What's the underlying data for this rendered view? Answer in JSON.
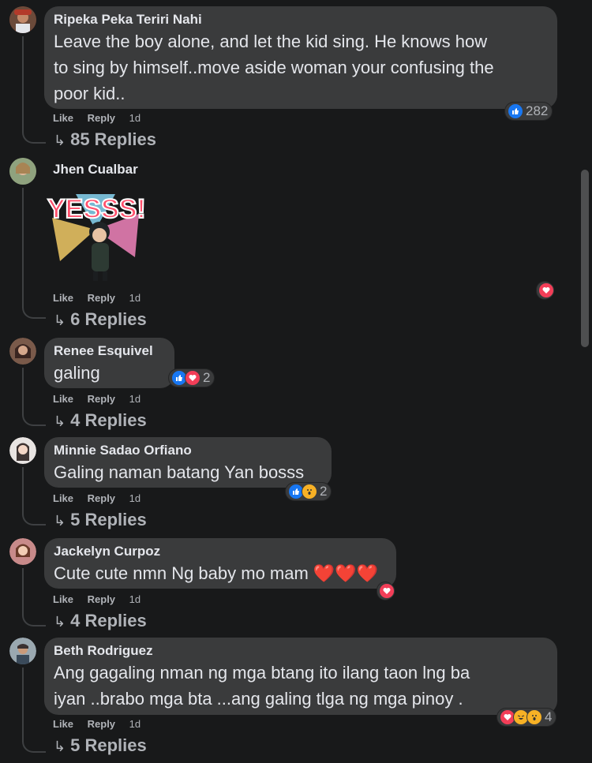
{
  "comments": [
    {
      "author": "Ripeka Peka Teriri Nahi",
      "text_lines": [
        "Leave the boy alone, and let the kid sing. He knows how",
        "to sing by himself..move aside woman your confusing the",
        "poor kid.."
      ],
      "like": "Like",
      "reply": "Reply",
      "time": "1d",
      "replies": "85 Replies",
      "reaction_count": "282",
      "reactions": [
        "like"
      ]
    },
    {
      "author": "Jhen Cualbar",
      "sticker_text": "YESSS!",
      "like": "Like",
      "reply": "Reply",
      "time": "1d",
      "replies": "6 Replies",
      "reaction_count": "",
      "reactions": [
        "love"
      ]
    },
    {
      "author": "Renee Esquivel",
      "text_lines": [
        "galing"
      ],
      "like": "Like",
      "reply": "Reply",
      "time": "1d",
      "replies": "4 Replies",
      "reaction_count": "2",
      "reactions": [
        "like",
        "love"
      ]
    },
    {
      "author": "Minnie Sadao Orfiano",
      "text_lines": [
        "Galing naman batang Yan bosss"
      ],
      "like": "Like",
      "reply": "Reply",
      "time": "1d",
      "replies": "5 Replies",
      "reaction_count": "2",
      "reactions": [
        "like",
        "wow"
      ]
    },
    {
      "author": "Jackelyn Curpoz",
      "text_lines": [
        "Cute cute nmn Ng baby mo mam ❤️❤️❤️"
      ],
      "like": "Like",
      "reply": "Reply",
      "time": "1d",
      "replies": "4 Replies",
      "reaction_count": "",
      "reactions": [
        "love"
      ]
    },
    {
      "author": "Beth Rodriguez",
      "text_lines": [
        "Ang gagaling nman ng mga btang ito ilang taon lng ba",
        "iyan ..brabo mga bta ...ang galing tlga ng mga pinoy ."
      ],
      "like": "Like",
      "reply": "Reply",
      "time": "1d",
      "replies": "5 Replies",
      "reaction_count": "4",
      "reactions": [
        "love",
        "haha",
        "wow"
      ]
    }
  ],
  "colors": {
    "background": "#18191a",
    "bubble": "#3a3b3c",
    "like": "#1877f2",
    "love": "#f33e58",
    "wow": "#f7b125"
  }
}
